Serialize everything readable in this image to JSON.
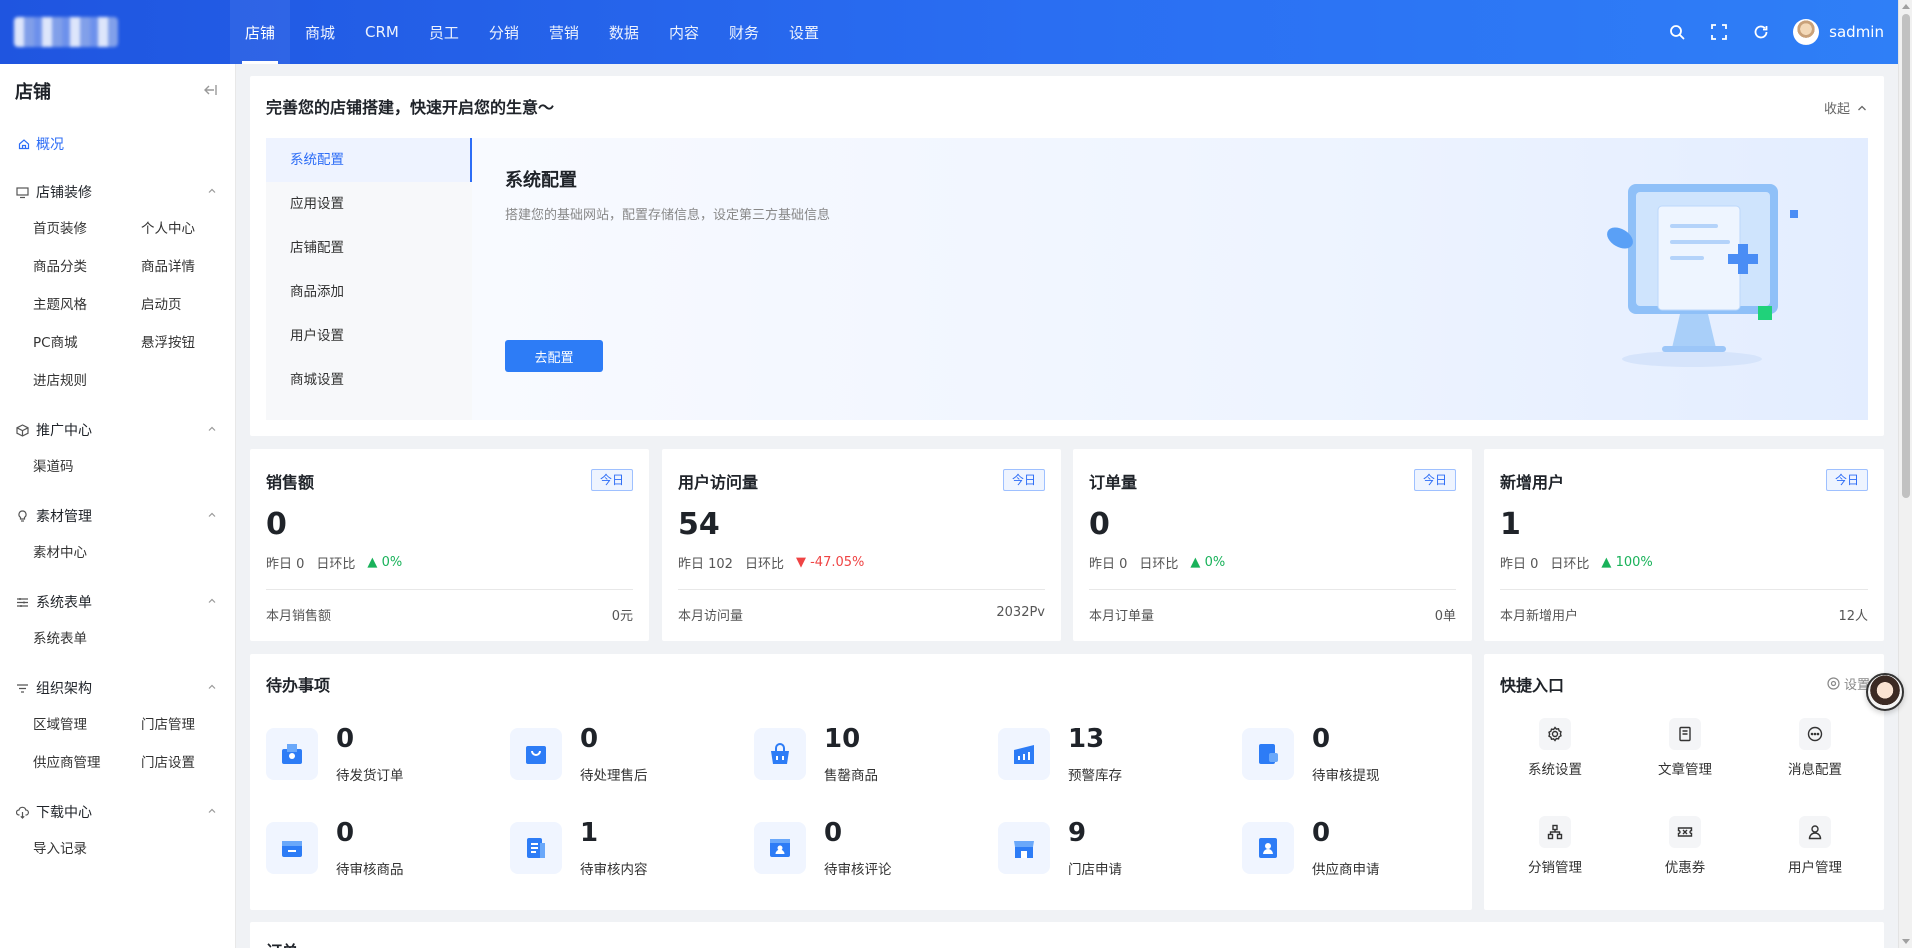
{
  "topbar": {
    "nav": [
      "店铺",
      "商城",
      "CRM",
      "员工",
      "分销",
      "营销",
      "数据",
      "内容",
      "财务",
      "设置"
    ],
    "active_index": 0,
    "username": "sadmin"
  },
  "sidebar": {
    "title": "店铺",
    "overview": "概况",
    "groups": [
      {
        "label": "店铺装修",
        "icon": "monitor-icon",
        "items": [
          "首页装修",
          "个人中心",
          "商品分类",
          "商品详情",
          "主题风格",
          "启动页",
          "PC商城",
          "悬浮按钮",
          "进店规则"
        ]
      },
      {
        "label": "推广中心",
        "icon": "cube-icon",
        "items": [
          "渠道码"
        ]
      },
      {
        "label": "素材管理",
        "icon": "bulb-icon",
        "items": [
          "素材中心"
        ]
      },
      {
        "label": "系统表单",
        "icon": "list-icon",
        "items": [
          "系统表单"
        ]
      },
      {
        "label": "组织架构",
        "icon": "filter-icon",
        "items": [
          "区域管理",
          "门店管理",
          "供应商管理",
          "门店设置"
        ]
      },
      {
        "label": "下载中心",
        "icon": "cloud-download-icon",
        "items": [
          "导入记录"
        ]
      }
    ]
  },
  "setup": {
    "title": "完善您的店铺搭建，快速开启您的生意～",
    "collapse": "收起",
    "tabs": [
      "系统配置",
      "应用设置",
      "店铺配置",
      "商品添加",
      "用户设置",
      "商城设置"
    ],
    "active_tab": 0,
    "panel_title": "系统配置",
    "panel_desc": "搭建您的基础网站，配置存储信息，设定第三方基础信息",
    "panel_button": "去配置"
  },
  "stats": [
    {
      "title": "销售额",
      "badge": "今日",
      "value": "0",
      "yesterday": "昨日 0",
      "compare_label": "日环比",
      "trend": "0%",
      "trend_dir": "up",
      "foot_label": "本月销售额",
      "foot_value": "0元"
    },
    {
      "title": "用户访问量",
      "badge": "今日",
      "value": "54",
      "yesterday": "昨日 102",
      "compare_label": "日环比",
      "trend": "-47.05%",
      "trend_dir": "down",
      "foot_label": "本月访问量",
      "foot_value": "2032Pv"
    },
    {
      "title": "订单量",
      "badge": "今日",
      "value": "0",
      "yesterday": "昨日 0",
      "compare_label": "日环比",
      "trend": "0%",
      "trend_dir": "up",
      "foot_label": "本月订单量",
      "foot_value": "0单"
    },
    {
      "title": "新增用户",
      "badge": "今日",
      "value": "1",
      "yesterday": "昨日 0",
      "compare_label": "日环比",
      "trend": "100%",
      "trend_dir": "up",
      "foot_label": "本月新增用户",
      "foot_value": "12人"
    }
  ],
  "todo": {
    "title": "待办事项",
    "items": [
      {
        "num": "0",
        "label": "待发货订单",
        "icon": "package-icon"
      },
      {
        "num": "0",
        "label": "待处理售后",
        "icon": "bag-icon"
      },
      {
        "num": "10",
        "label": "售罄商品",
        "icon": "basket-icon"
      },
      {
        "num": "13",
        "label": "预警库存",
        "icon": "chart-icon"
      },
      {
        "num": "0",
        "label": "待审核提现",
        "icon": "wallet-icon"
      },
      {
        "num": "0",
        "label": "待审核商品",
        "icon": "box-icon"
      },
      {
        "num": "1",
        "label": "待审核内容",
        "icon": "doc-icon"
      },
      {
        "num": "0",
        "label": "待审核评论",
        "icon": "comment-icon"
      },
      {
        "num": "9",
        "label": "门店申请",
        "icon": "store-icon"
      },
      {
        "num": "0",
        "label": "供应商申请",
        "icon": "badge-icon"
      }
    ]
  },
  "quick": {
    "title": "快捷入口",
    "settings": "设置",
    "items": [
      {
        "label": "系统设置",
        "icon": "gear-icon"
      },
      {
        "label": "文章管理",
        "icon": "article-icon"
      },
      {
        "label": "消息配置",
        "icon": "message-icon"
      },
      {
        "label": "分销管理",
        "icon": "hierarchy-icon"
      },
      {
        "label": "优惠券",
        "icon": "coupon-icon"
      },
      {
        "label": "用户管理",
        "icon": "user-icon"
      }
    ]
  },
  "bottom": {
    "title": "订单"
  },
  "colors": {
    "primary": "#2d6df6",
    "up": "#19b25a",
    "down": "#ef4444"
  }
}
